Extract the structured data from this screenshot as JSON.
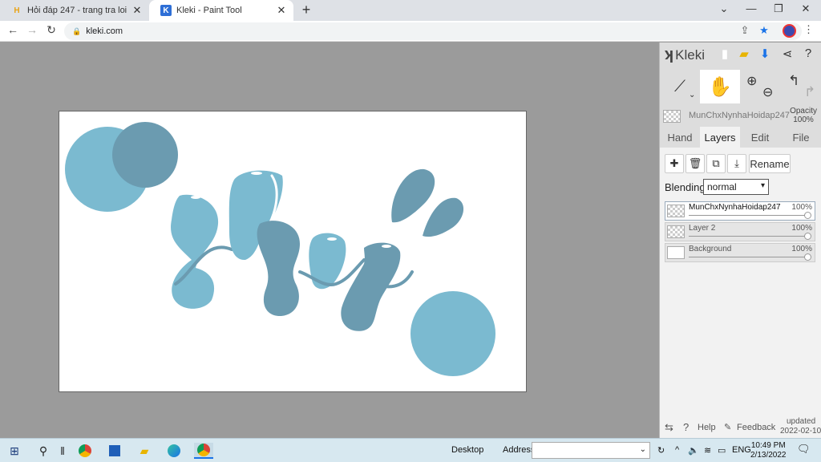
{
  "browser": {
    "tabs": [
      {
        "title": "Hỏi đáp 247 - trang tra loi",
        "active": false
      },
      {
        "title": "Kleki - Paint Tool",
        "active": true
      }
    ],
    "url": "kleki.com"
  },
  "app": {
    "logo": "Kleki",
    "active_layer_name": "MunChxNynhaHoidap247",
    "opacity_label": "Opacity",
    "opacity_value": "100%",
    "tabs": [
      "Hand",
      "Layers",
      "Edit",
      "File"
    ],
    "active_tab": "Layers",
    "rename_label": "Rename",
    "blending_label": "Blending",
    "blending_value": "normal",
    "layers": [
      {
        "name": "MunChxNynhaHoidap247",
        "opacity": "100%",
        "selected": true
      },
      {
        "name": "Layer 2",
        "opacity": "100%",
        "selected": false
      },
      {
        "name": "Background",
        "opacity": "100%",
        "selected": false
      }
    ],
    "footer": {
      "help": "Help",
      "feedback": "Feedback",
      "updated_label": "updated",
      "updated_date": "2022-02-10"
    }
  },
  "canvas": {
    "colors": {
      "light_blue": "#7bbad0",
      "dark_blue": "#6b9bb0"
    }
  },
  "taskbar": {
    "desktop_label": "Desktop",
    "address_label": "Address",
    "language": "ENG",
    "time": "10:49 PM",
    "date": "2/13/2022"
  }
}
